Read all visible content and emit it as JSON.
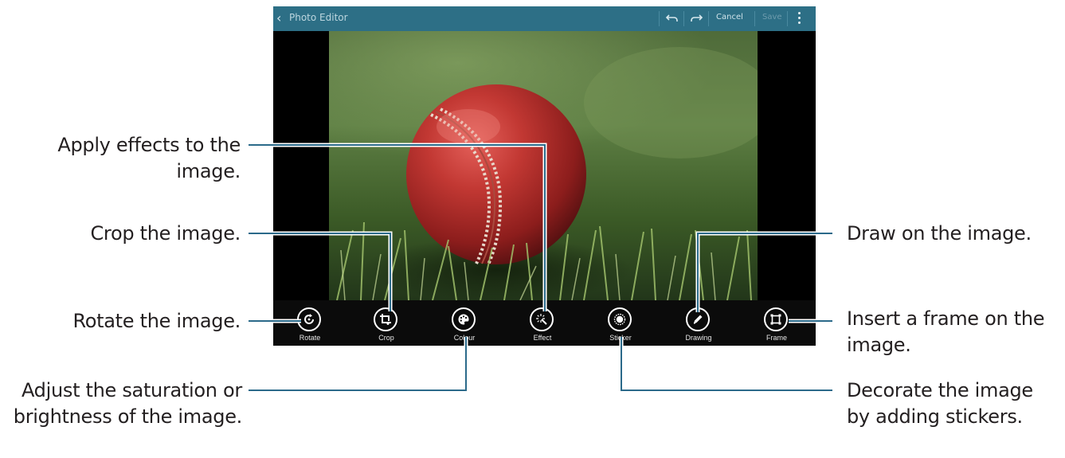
{
  "app": {
    "title": "Photo Editor",
    "actions": {
      "cancel": "Cancel",
      "save": "Save"
    }
  },
  "icons": {
    "back": "chevron-left-icon",
    "undo": "undo-icon",
    "redo": "redo-icon",
    "more": "more-vertical-icon"
  },
  "toolbar": {
    "tools": [
      {
        "label": "Rotate",
        "icon": "rotate-icon"
      },
      {
        "label": "Crop",
        "icon": "crop-icon"
      },
      {
        "label": "Colour",
        "icon": "palette-icon"
      },
      {
        "label": "Effect",
        "icon": "magic-wand-icon"
      },
      {
        "label": "Sticker",
        "icon": "sticker-icon"
      },
      {
        "label": "Drawing",
        "icon": "pencil-icon"
      },
      {
        "label": "Frame",
        "icon": "frame-icon"
      }
    ]
  },
  "callouts": {
    "effect": "Apply effects to the image.",
    "crop": "Crop the image.",
    "rotate": "Rotate the image.",
    "colour": "Adjust the saturation or brightness of the image.",
    "drawing": "Draw on the image.",
    "frame": "Insert a frame on the image.",
    "sticker": "Decorate the image by adding stickers."
  },
  "colors": {
    "titlebar": "#2d6f86",
    "callout_line": "#2b6a8a",
    "text": "#231f20"
  }
}
